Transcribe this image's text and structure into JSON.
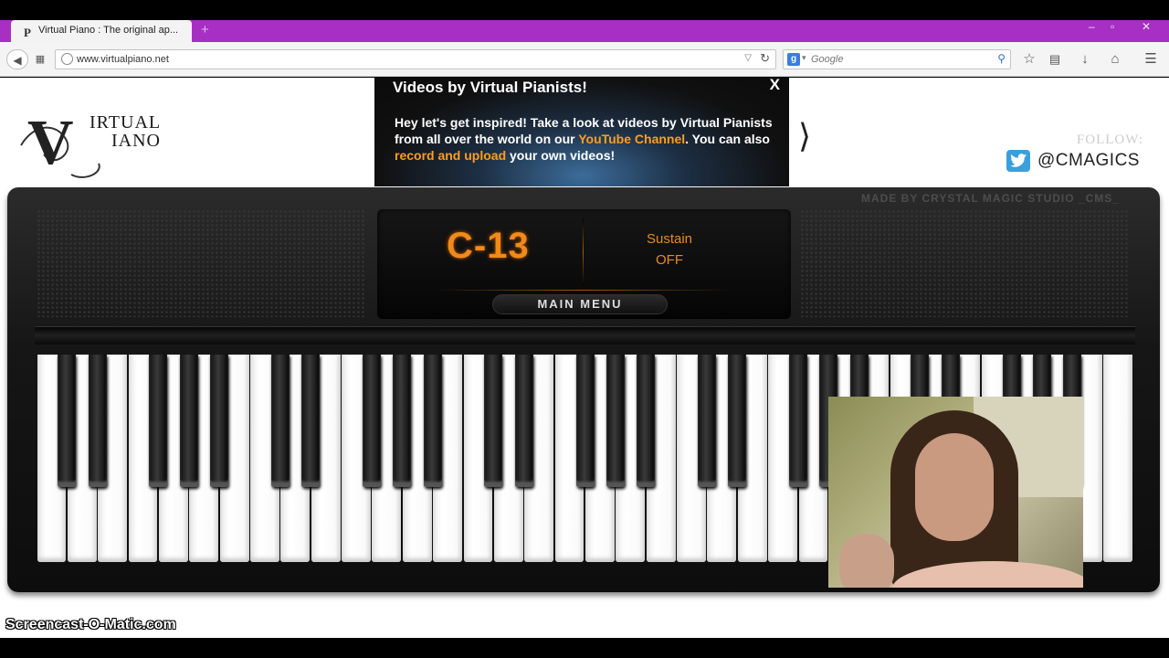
{
  "browser": {
    "tab_title": "Virtual Piano : The original ap...",
    "tab_favicon": "P",
    "new_tab": "+",
    "url": "www.virtualpiano.net",
    "search_engine": "g",
    "search_placeholder": "Google",
    "window_controls": [
      "–",
      "▫",
      "✕"
    ]
  },
  "header": {
    "logo_line1": "IRTUAL",
    "logo_line2": "IANO",
    "ad": {
      "title": "Videos by Virtual Pianists!",
      "body_pre": "Hey let's get inspired! Take a look at videos by Virtual Pianists from all over the world on our ",
      "link1": "YouTube Channel",
      "body_mid": ". You can also ",
      "link2": "record and upload",
      "body_post": " your own videos!",
      "close": "X"
    },
    "follow_label": "FOLLOW:",
    "twitter_handle": "@CMAGICS"
  },
  "piano": {
    "made_by": "MADE BY CRYSTAL MAGIC STUDIO _CMS_",
    "note_display": "C-13",
    "sustain_label": "Sustain",
    "sustain_state": "OFF",
    "main_menu": "MAIN MENU",
    "white_keys": 36,
    "black_key_pattern": [
      1,
      1,
      0,
      1,
      1,
      1,
      0
    ]
  },
  "watermark": "Screencast-O-Matic.com",
  "colors": {
    "tab_bar": "#a72fc4",
    "display_orange": "#f08a1a",
    "link_orange": "#ff9d1e",
    "twitter_blue": "#3aa0dc"
  }
}
